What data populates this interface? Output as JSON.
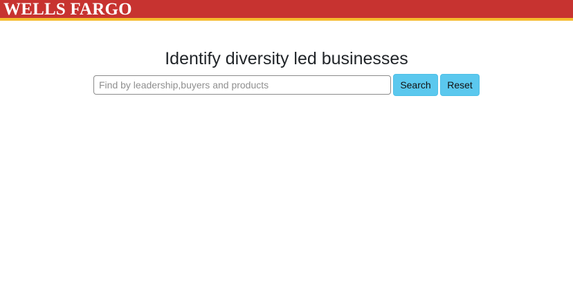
{
  "header": {
    "logo_text": "WELLS FARGO",
    "colors": {
      "bar": "#c73330",
      "accent_stripe": "#f5bb2e",
      "logo_text": "#ffffff"
    }
  },
  "main": {
    "title": "Identify diversity led businesses",
    "search": {
      "value": "",
      "placeholder": "Find by leadership,buyers and products"
    },
    "buttons": {
      "search_label": "Search",
      "reset_label": "Reset",
      "color": "#5bc8ee"
    }
  }
}
